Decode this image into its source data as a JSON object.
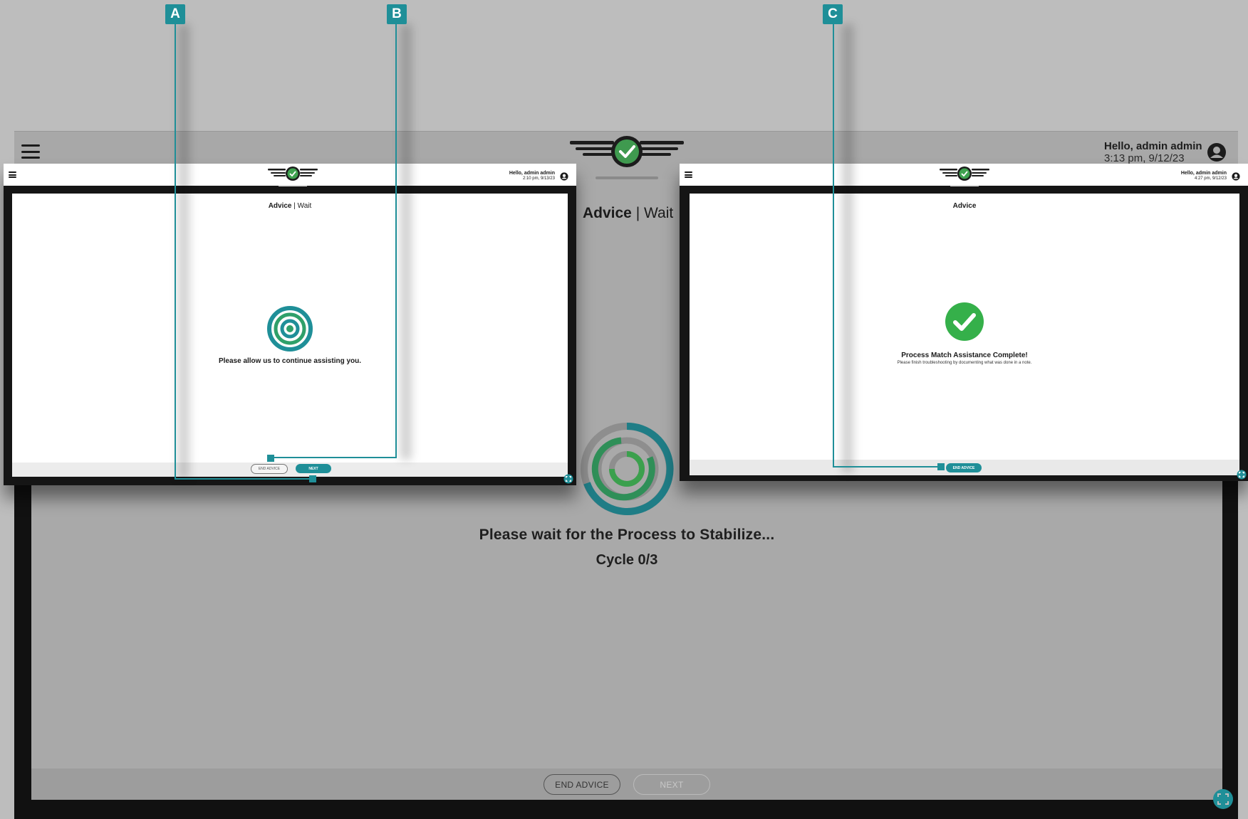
{
  "background_screen": {
    "greeting": "Hello, admin admin",
    "timestamp": "3:13 pm, 9/12/23",
    "title_bold": "Advice",
    "title_separator": " | ",
    "title_rest": "Wait",
    "wait_message": "Please wait for the Process to Stabilize...",
    "cycle_text": "Cycle 0/3",
    "end_advice_label": "END ADVICE",
    "next_label": "NEXT"
  },
  "window_a": {
    "greeting": "Hello, admin admin",
    "timestamp": "2:10 pm, 9/13/23",
    "title_bold": "Advice",
    "title_separator": " | ",
    "title_rest": "Wait",
    "message": "Please allow us to continue assisting you.",
    "end_advice_label": "END ADVICE",
    "next_label": "NEXT"
  },
  "window_c": {
    "greeting": "Hello, admin admin",
    "timestamp": "4:27 pm, 9/12/23",
    "title": "Advice",
    "heading": "Process Match Assistance Complete!",
    "subtext": "Please finish troubleshooting by documenting what was done in a note.",
    "end_advice_label": "END ADVICE"
  },
  "callouts": {
    "a": "A",
    "b": "B",
    "c": "C"
  },
  "colors": {
    "teal": "#1f8f98",
    "green": "#35b04a",
    "dark": "#151515"
  },
  "icons": [
    "hamburger-menu-icon",
    "logo-wings-check-icon",
    "user-account-icon",
    "target-rings-icon",
    "check-circle-icon",
    "expand-icon",
    "progress-ring-icon"
  ]
}
